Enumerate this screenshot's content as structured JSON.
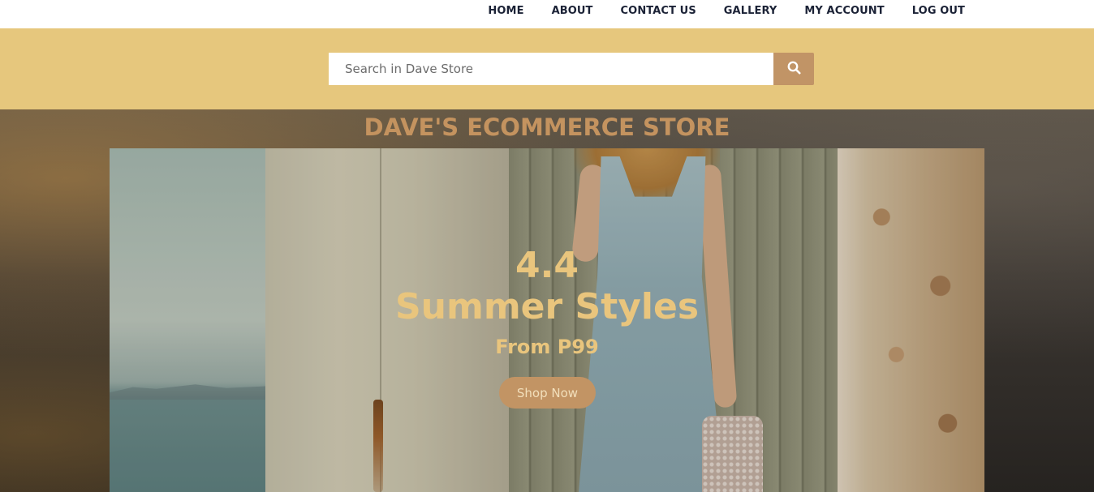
{
  "nav": {
    "items": [
      {
        "label": "HOME"
      },
      {
        "label": "ABOUT"
      },
      {
        "label": "CONTACT US"
      },
      {
        "label": "GALLERY"
      },
      {
        "label": "MY ACCOUNT"
      },
      {
        "label": "LOG OUT"
      }
    ]
  },
  "search": {
    "placeholder": "Search in Dave Store",
    "value": "",
    "button_icon": "search-icon"
  },
  "hero": {
    "store_title": "DAVE'S ECOMMERCE STORE",
    "promo_number": "4.4",
    "promo_title": "Summer Styles",
    "promo_price": "From P99",
    "cta_label": "Shop Now"
  },
  "colors": {
    "nav_text": "#1b2236",
    "search_band": "#e6c77d",
    "search_button": "#c19466",
    "store_title": "#c4935f",
    "promo_text": "#e9c57d",
    "cta_background": "#c29464"
  }
}
